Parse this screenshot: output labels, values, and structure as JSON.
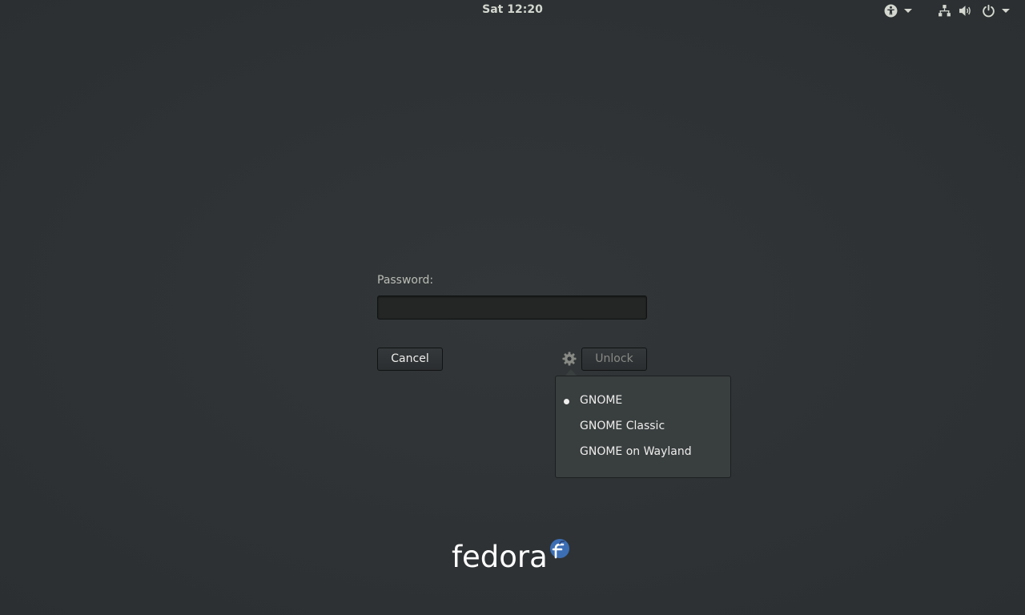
{
  "topbar": {
    "clock": "Sat 12:20",
    "icons": {
      "accessibility": "accessibility-icon",
      "network": "network-wired-icon",
      "volume": "volume-icon",
      "power": "power-icon"
    }
  },
  "prompt": {
    "password_label": "Password:",
    "password_value": "",
    "cancel_label": "Cancel",
    "unlock_label": "Unlock"
  },
  "session_menu": {
    "selected": "GNOME",
    "items": [
      "GNOME",
      "GNOME Classic",
      "GNOME on Wayland"
    ]
  },
  "branding": {
    "logo_text": "fedora"
  },
  "colors": {
    "background": "#2e3234",
    "menu_background": "#393e3f",
    "text": "#eeeeec",
    "disabled_text": "#888a85",
    "fedora_blue": "#3c6eb4"
  }
}
